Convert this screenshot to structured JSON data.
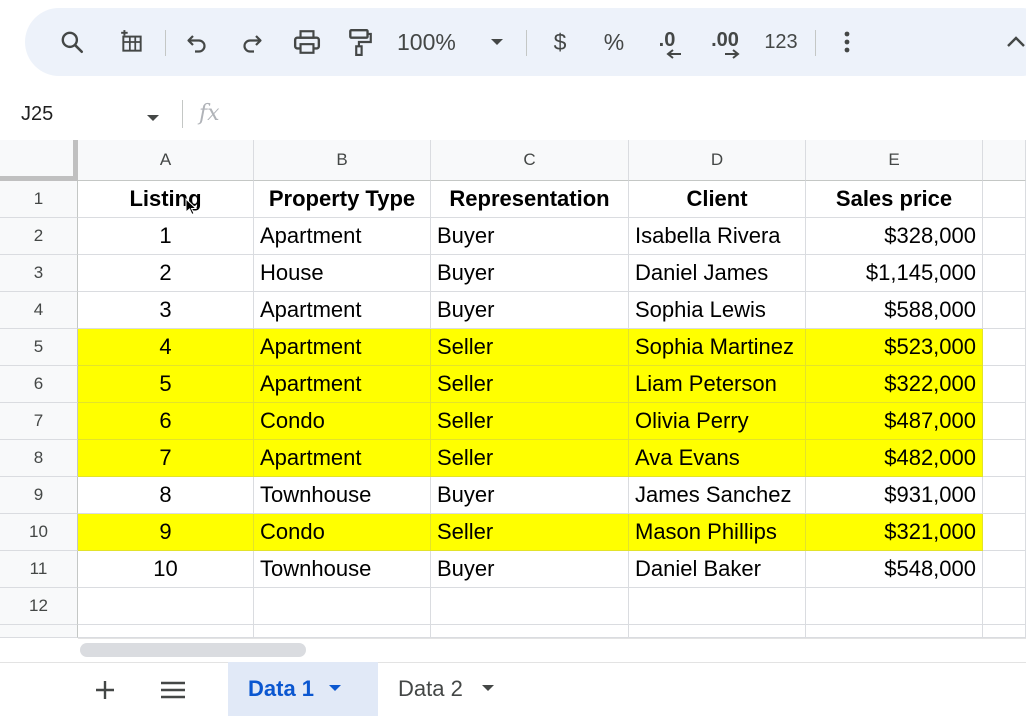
{
  "toolbar": {
    "zoom": "100%",
    "currency_label": "$",
    "percent_label": "%",
    "decrease_decimal_label": ".0",
    "increase_decimal_label": ".00",
    "more_formats_label": "123"
  },
  "formula_bar": {
    "cell_ref": "J25",
    "fx_label": "fx",
    "value": ""
  },
  "columns": [
    "A",
    "B",
    "C",
    "D",
    "E"
  ],
  "rows": [
    {
      "num": "1",
      "header": true,
      "highlight": false,
      "cells": [
        "Listing",
        "Property Type",
        "Representation",
        "Client",
        "Sales price"
      ]
    },
    {
      "num": "2",
      "highlight": false,
      "cells": [
        "1",
        "Apartment",
        "Buyer",
        "Isabella Rivera",
        "$328,000"
      ]
    },
    {
      "num": "3",
      "highlight": false,
      "cells": [
        "2",
        "House",
        "Buyer",
        "Daniel James",
        "$1,145,000"
      ]
    },
    {
      "num": "4",
      "highlight": false,
      "cells": [
        "3",
        "Apartment",
        "Buyer",
        "Sophia Lewis",
        "$588,000"
      ]
    },
    {
      "num": "5",
      "highlight": true,
      "cells": [
        "4",
        "Apartment",
        "Seller",
        "Sophia Martinez",
        "$523,000"
      ]
    },
    {
      "num": "6",
      "highlight": true,
      "cells": [
        "5",
        "Apartment",
        "Seller",
        "Liam Peterson",
        "$322,000"
      ]
    },
    {
      "num": "7",
      "highlight": true,
      "cells": [
        "6",
        "Condo",
        "Seller",
        "Olivia Perry",
        "$487,000"
      ]
    },
    {
      "num": "8",
      "highlight": true,
      "cells": [
        "7",
        "Apartment",
        "Seller",
        "Ava Evans",
        "$482,000"
      ]
    },
    {
      "num": "9",
      "highlight": false,
      "cells": [
        "8",
        "Townhouse",
        "Buyer",
        "James Sanchez",
        "$931,000"
      ]
    },
    {
      "num": "10",
      "highlight": true,
      "cells": [
        "9",
        "Condo",
        "Seller",
        "Mason Phillips",
        "$321,000"
      ]
    },
    {
      "num": "11",
      "highlight": false,
      "cells": [
        "10",
        "Townhouse",
        "Buyer",
        "Daniel Baker",
        "$548,000"
      ]
    },
    {
      "num": "12",
      "highlight": false,
      "cells": [
        "",
        "",
        "",
        "",
        ""
      ]
    }
  ],
  "sheets": {
    "active": "Data 1",
    "other": "Data 2"
  },
  "colors": {
    "highlight": "#ffff00",
    "toolbar_bg": "#edf2fa",
    "active_tab_text": "#0b57d0",
    "active_tab_bg": "#e1e9f7"
  },
  "icons": [
    "search-icon",
    "clear-format-icon",
    "undo-icon",
    "redo-icon",
    "print-icon",
    "paint-format-icon",
    "chevron-down-icon",
    "more-vert-icon",
    "chevron-up-icon",
    "plus-icon",
    "menu-icon"
  ]
}
